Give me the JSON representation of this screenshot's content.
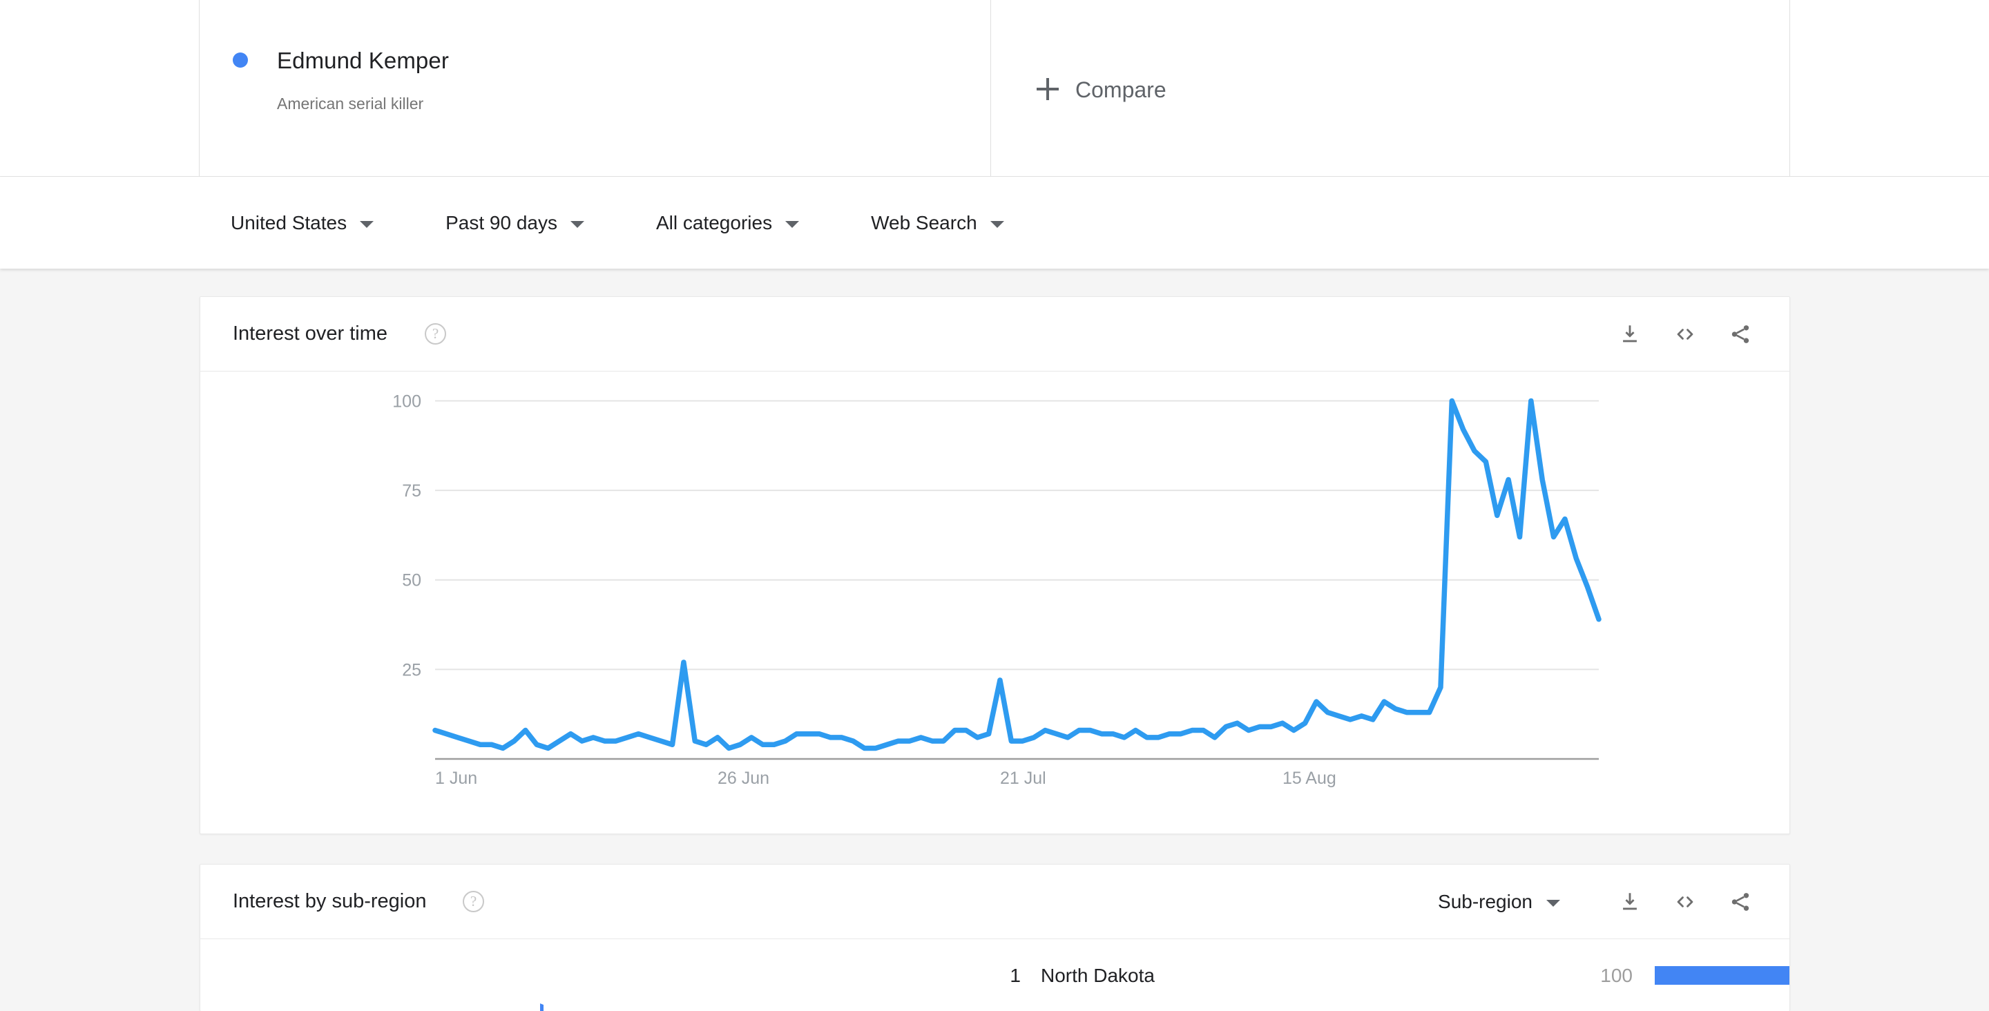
{
  "header": {
    "term": {
      "name": "Edmund Kemper",
      "description": "American serial killer",
      "dot_color": "#4285f4"
    },
    "compare": {
      "label": "Compare",
      "icon": "plus-icon"
    }
  },
  "filters": [
    {
      "id": "location",
      "label": "United States"
    },
    {
      "id": "time-range",
      "label": "Past 90 days"
    },
    {
      "id": "category",
      "label": "All categories"
    },
    {
      "id": "search-type",
      "label": "Web Search"
    }
  ],
  "cards": {
    "interest_over_time": {
      "title": "Interest over time",
      "help_icon": "help-icon",
      "actions": [
        {
          "id": "download",
          "icon": "download-icon"
        },
        {
          "id": "embed",
          "icon": "embed-code-icon"
        },
        {
          "id": "share",
          "icon": "share-icon"
        }
      ]
    },
    "interest_by_subregion": {
      "title": "Interest by sub-region",
      "help_icon": "help-icon",
      "selector": {
        "label": "Sub-region",
        "icon": "chevron-down-icon"
      },
      "actions": [
        {
          "id": "download",
          "icon": "download-icon"
        },
        {
          "id": "embed",
          "icon": "embed-code-icon"
        },
        {
          "id": "share",
          "icon": "share-icon"
        }
      ],
      "columns": [
        "rank",
        "region",
        "value"
      ],
      "rows": [
        {
          "rank": "1",
          "region": "North Dakota",
          "value": "100",
          "bar_pct": 100
        }
      ]
    }
  },
  "chart_data": {
    "type": "line",
    "title": "Interest over time",
    "xlabel": "",
    "ylabel": "",
    "ylim": [
      0,
      108
    ],
    "grid": true,
    "legend": false,
    "line_color": "#2e9bf0",
    "ytick_labels": [
      "100",
      "75",
      "50",
      "25"
    ],
    "ytick_values": [
      100,
      75,
      50,
      25
    ],
    "xtick_labels": [
      "1 Jun",
      "26 Jun",
      "21 Jul",
      "15 Aug"
    ],
    "xtick_indices": [
      0,
      25,
      50,
      75
    ],
    "series": [
      {
        "name": "Edmund Kemper",
        "values": [
          8,
          7,
          6,
          5,
          4,
          4,
          3,
          5,
          8,
          4,
          3,
          5,
          7,
          5,
          6,
          5,
          5,
          6,
          7,
          6,
          5,
          4,
          27,
          5,
          4,
          6,
          3,
          4,
          6,
          4,
          4,
          5,
          7,
          7,
          7,
          6,
          6,
          5,
          3,
          3,
          4,
          5,
          5,
          6,
          5,
          5,
          8,
          8,
          6,
          7,
          22,
          5,
          5,
          6,
          8,
          7,
          6,
          8,
          8,
          7,
          7,
          6,
          8,
          6,
          6,
          7,
          7,
          8,
          8,
          6,
          9,
          10,
          8,
          9,
          9,
          10,
          8,
          10,
          16,
          13,
          12,
          11,
          12,
          11,
          16,
          14,
          13,
          13,
          13,
          20,
          100,
          92,
          86,
          83,
          68,
          78,
          62,
          100,
          78,
          62,
          67,
          56,
          48,
          39
        ]
      }
    ]
  }
}
